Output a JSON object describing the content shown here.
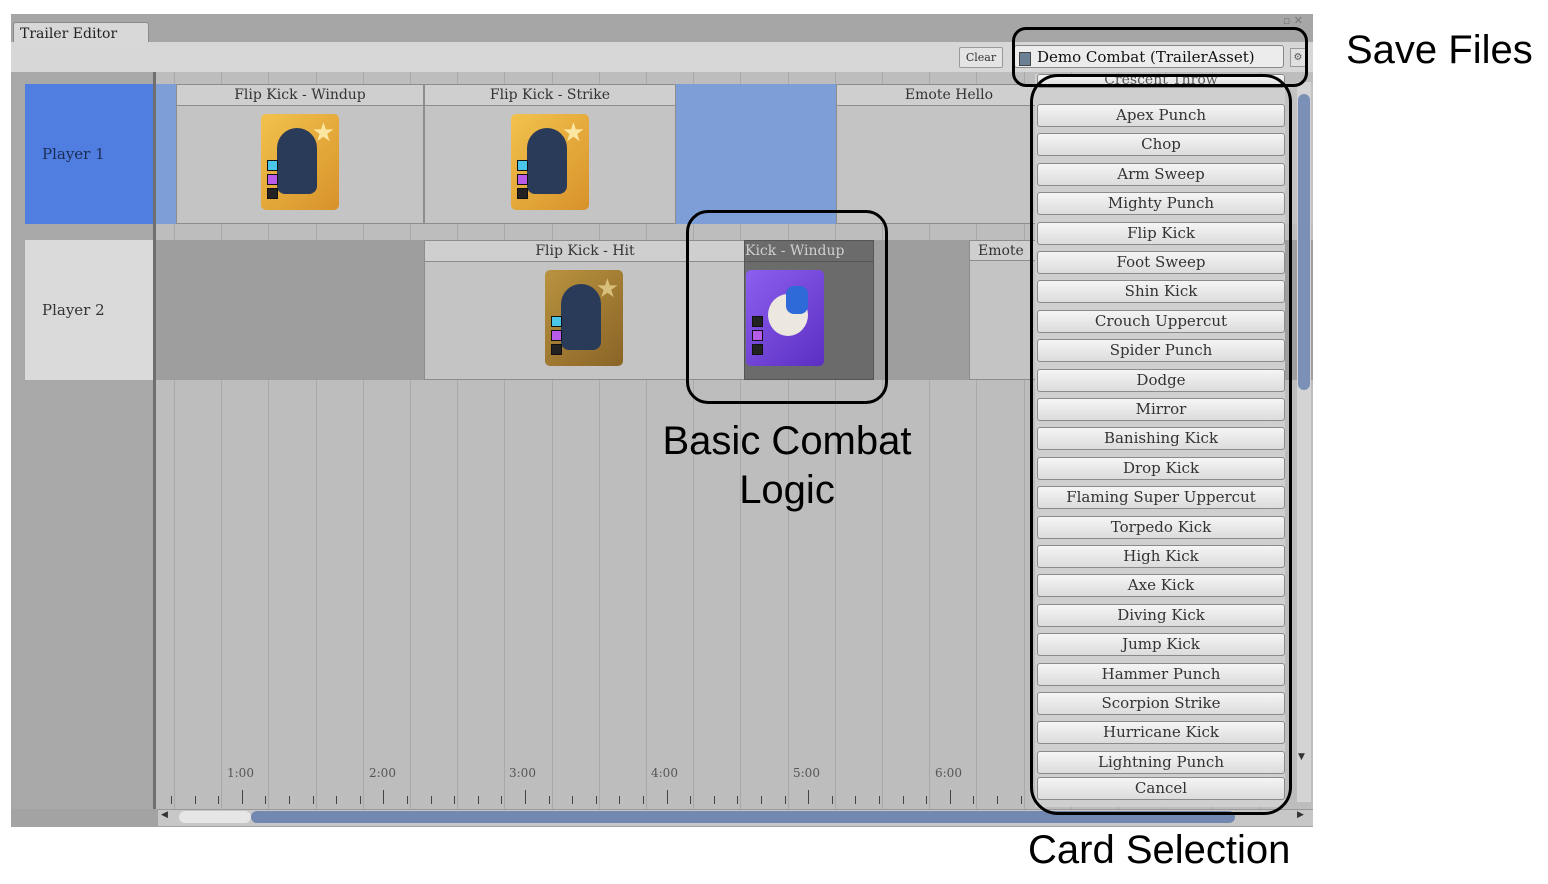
{
  "window": {
    "tab_title": "Trailer Editor",
    "controls": "▫ ✕"
  },
  "toolbar": {
    "clear_label": "Clear",
    "asset_value": "Demo Combat (TrailerAsset)",
    "gear_glyph": "⚙"
  },
  "tracks": [
    {
      "label": "Player 1"
    },
    {
      "label": "Player 2"
    }
  ],
  "clips": {
    "p1": [
      "Flip Kick - Windup",
      "Flip Kick - Strike",
      "Emote Hello"
    ],
    "p2": [
      "Flip Kick - Hit",
      "Kick - Windup",
      "Emote"
    ]
  },
  "timeline": {
    "labels": [
      "1:00",
      "2:00",
      "3:00",
      "4:00",
      "5:00",
      "6:00"
    ]
  },
  "card_list": {
    "partial_top": "Crescent Throw",
    "items": [
      "Apex Punch",
      "Chop",
      "Arm Sweep",
      "Mighty Punch",
      "Flip Kick",
      "Foot Sweep",
      "Shin Kick",
      "Crouch Uppercut",
      "Spider Punch",
      "Dodge",
      "Mirror",
      "Banishing Kick",
      "Drop Kick",
      "Flaming Super Uppercut",
      "Torpedo Kick",
      "High Kick",
      "Axe Kick",
      "Diving Kick",
      "Jump Kick",
      "Hammer Punch",
      "Scorpion Strike",
      "Hurricane Kick",
      "Lightning Punch"
    ],
    "cancel_label": "Cancel"
  },
  "annotations": {
    "save_files": "Save Files",
    "combat_line1": "Basic Combat",
    "combat_line2": "Logic",
    "card_selection": "Card Selection"
  },
  "colors": {
    "selected_track": "#4f7ee0",
    "selected_row": "#7e9ed8",
    "scroll_thumb": "#7288b0"
  }
}
